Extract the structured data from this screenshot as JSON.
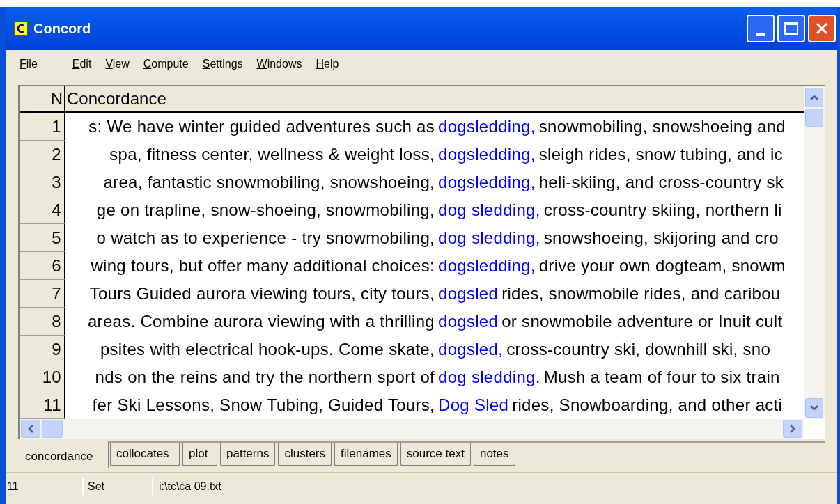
{
  "window": {
    "title": "Concord"
  },
  "menu": [
    "File",
    "Edit",
    "View",
    "Compute",
    "Settings",
    "Windows",
    "Help"
  ],
  "table": {
    "columns": [
      "N",
      "Concordance"
    ],
    "rows": [
      {
        "n": "1",
        "left": "s: We have winter guided adventures such as",
        "key": "dogsledding,",
        "right": "snowmobiling, snowshoeing and"
      },
      {
        "n": "2",
        "left": "spa, fitness center, wellness & weight loss,",
        "key": "dogsledding,",
        "right": "sleigh rides, snow tubing, and ic"
      },
      {
        "n": "3",
        "left": "area, fantastic snowmobiling, snowshoeing,",
        "key": "dogsledding,",
        "right": "heli-skiing, and cross-country sk"
      },
      {
        "n": "4",
        "left": "ge on trapline, snow-shoeing, snowmobiling,",
        "key": "dog sledding,",
        "right": "cross-country skiing, northern li"
      },
      {
        "n": "5",
        "left": "o watch as to experience - try snowmobiling,",
        "key": "dog sledding,",
        "right": "snowshoeing, skijoring and cro"
      },
      {
        "n": "6",
        "left": "wing tours, but offer many additional choices:",
        "key": "dogsledding,",
        "right": "drive your own dogteam, snowm"
      },
      {
        "n": "7",
        "left": "Tours Guided aurora viewing tours, city tours,",
        "key": "dogsled",
        "right": "rides, snowmobile rides, and caribou"
      },
      {
        "n": "8",
        "left": "areas. Combine aurora viewing with a thrilling",
        "key": "dogsled",
        "right": "or snowmobile adventure or Inuit cult"
      },
      {
        "n": "9",
        "left": "psites with electrical hook-ups. Come skate,",
        "key": "dogsled,",
        "right": "cross-country ski, downhill ski, sno"
      },
      {
        "n": "10",
        "left": "nds on the reins and try the northern sport of",
        "key": "dog sledding.",
        "right": "Mush a team of four to six train"
      },
      {
        "n": "11",
        "left": "fer Ski Lessons, Snow Tubing, Guided Tours,",
        "key": "Dog Sled",
        "right": "rides, Snowboarding, and other acti"
      }
    ]
  },
  "tabs": [
    {
      "label": "concordance",
      "selected": true
    },
    {
      "label": "collocates",
      "selected": false
    },
    {
      "label": "plot",
      "selected": false
    },
    {
      "label": "patterns",
      "selected": false
    },
    {
      "label": "clusters",
      "selected": false
    },
    {
      "label": "filenames",
      "selected": false
    },
    {
      "label": "source text",
      "selected": false
    },
    {
      "label": "notes",
      "selected": false
    }
  ],
  "status_bar": [
    "11",
    "Set",
    "i:\\tc\\ca 09.txt"
  ]
}
